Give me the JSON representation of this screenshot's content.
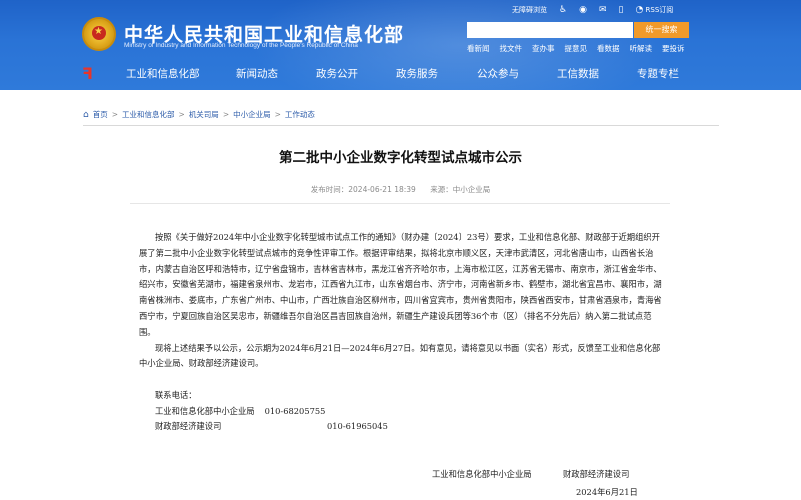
{
  "header": {
    "site_title": "中华人民共和国工业和信息化部",
    "site_subtitle": "Ministry of Industry and Information Technology of the People's Republic of China",
    "util": {
      "accessibility": "无障碍浏览",
      "rss": "RSS订阅"
    },
    "search": {
      "placeholder": "",
      "button": "统一搜索"
    },
    "hot_links": [
      "看新闻",
      "找文件",
      "查办事",
      "提意见",
      "看数据",
      "听解读",
      "要投诉"
    ],
    "nav": [
      "工业和信息化部",
      "新闻动态",
      "政务公开",
      "政务服务",
      "公众参与",
      "工信数据",
      "专题专栏"
    ]
  },
  "breadcrumb": [
    "首页",
    "工业和信息化部",
    "机关司局",
    "中小企业局",
    "工作动态"
  ],
  "article": {
    "title": "第二批中小企业数字化转型试点城市公示",
    "published": "发布时间：2024-06-21 18:39",
    "source": "来源：中小企业局",
    "paragraph1": "按照《关于做好2024年中小企业数字化转型城市试点工作的通知》（财办建〔2024〕23号）要求，工业和信息化部、财政部于近期组织开展了第二批中小企业数字化转型试点城市的竞争性评审工作。根据评审结果，拟将北京市顺义区，天津市武清区，河北省唐山市，山西省长治市，内蒙古自治区呼和浩特市，辽宁省盘锦市，吉林省吉林市，黑龙江省齐齐哈尔市，上海市松江区，江苏省无锡市、南京市，浙江省金华市、绍兴市，安徽省芜湖市，福建省泉州市、龙岩市，江西省九江市，山东省烟台市、济宁市，河南省新乡市、鹤壁市，湖北省宜昌市、襄阳市，湖南省株洲市、娄底市，广东省广州市、中山市，广西壮族自治区柳州市，四川省宜宾市，贵州省贵阳市，陕西省西安市，甘肃省酒泉市，青海省西宁市，宁夏回族自治区吴忠市，新疆维吾尔自治区昌吉回族自治州，新疆生产建设兵团等36个市（区）（排名不分先后）纳入第二批试点范围。",
    "paragraph2": "现将上述结果予以公示，公示期为2024年6月21日—2024年6月27日。如有意见，请将意见以书面（实名）形式，反馈至工业和信息化部中小企业局、财政部经济建设司。",
    "contact_label": "联系电话：",
    "contacts": [
      {
        "org": "工业和信息化部中小企业局",
        "phone": "010-68205755"
      },
      {
        "org": "财政部经济建设司",
        "phone": "010-61965045"
      }
    ],
    "signatories": [
      "工业和信息化部中小企业局",
      "财政部经济建设司"
    ],
    "date": "2024年6月21日"
  },
  "colors": {
    "header_blue": "#2a73d6",
    "search_button": "#f19a2a",
    "link_blue": "#2a5aa8"
  },
  "icons": [
    "emblem-icon",
    "accessibility-icon",
    "elder-icon",
    "weibo-icon",
    "wechat-icon",
    "rss-icon",
    "home-icon"
  ]
}
